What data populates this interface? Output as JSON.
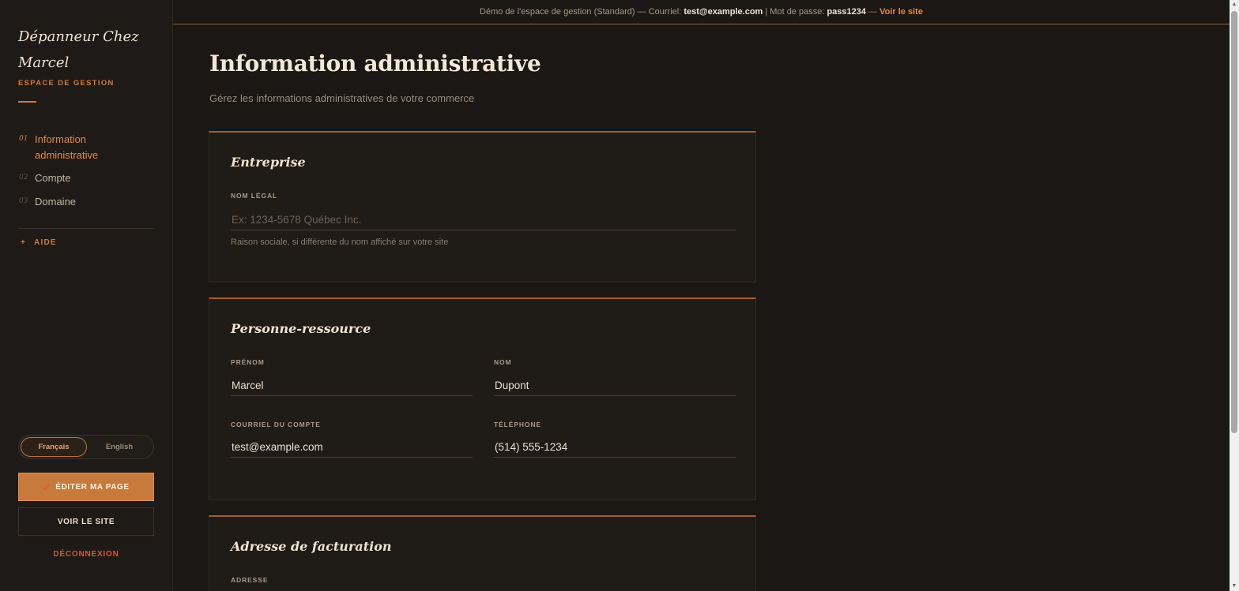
{
  "sidebar": {
    "brand": "Dépanneur Chez Marcel",
    "subtitle": "ESPACE DE GESTION",
    "nav": [
      {
        "num": "01",
        "label": "Information administrative"
      },
      {
        "num": "02",
        "label": "Compte"
      },
      {
        "num": "03",
        "label": "Domaine"
      }
    ],
    "help_icon": "+",
    "help_label": "AIDE",
    "lang": {
      "fr": "Français",
      "en": "English",
      "selected": "Français"
    },
    "edit_icon": "pencil-icon",
    "edit_button": "ÉDITER MA PAGE",
    "view_button": "VOIR LE SITE",
    "logout": "DÉCONNEXION"
  },
  "topbar": {
    "demo_text": "Démo de l'espace de gestion (Standard) — Courriel: ",
    "email": "test@example.com",
    "password_label": " | Mot de passe: ",
    "password": "pass1234",
    "sep": " — ",
    "link": "Voir le site"
  },
  "page": {
    "title": "Information administrative",
    "subtitle": "Gérez les informations administratives de votre commerce"
  },
  "entreprise": {
    "title": "Entreprise",
    "nom_legal_label": "NOM LÉGAL",
    "nom_legal_placeholder": "Ex: 1234-5678 Québec Inc.",
    "nom_legal_help": "Raison sociale, si différente du nom affiché sur votre site"
  },
  "contact": {
    "title": "Personne-ressource",
    "prenom_label": "PRÉNOM",
    "prenom_value": "Marcel",
    "nom_label": "NOM",
    "nom_value": "Dupont",
    "courriel_label": "COURRIEL DU COMPTE",
    "courriel_value": "test@example.com",
    "telephone_label": "TÉLÉPHONE",
    "telephone_value": "(514) 555-1234"
  },
  "facturation": {
    "title": "Adresse de facturation",
    "adresse_label": "ADRESSE"
  },
  "colors": {
    "accent": "#d07a3a",
    "background": "#1a1714",
    "danger": "#d9553e"
  }
}
